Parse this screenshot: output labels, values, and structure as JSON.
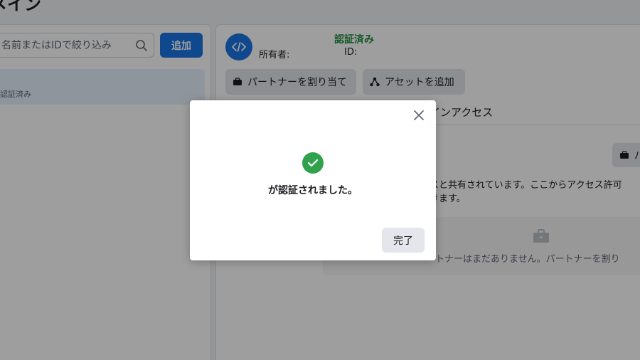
{
  "page": {
    "title": "メイン"
  },
  "left_panel": {
    "search": {
      "placeholder": "名前またはIDで絞り込み"
    },
    "add_button_label": "追加",
    "list": [
      {
        "status": "認証済み"
      }
    ]
  },
  "right_panel": {
    "status": "認証済み",
    "owner_label": "所有者:",
    "id_label": "ID:",
    "assign_partner_label": "パートナーを割り当て",
    "add_asset_label": "アセットを追加",
    "tab_access_label": "インアクセス",
    "partner_small_label": "パ",
    "shared_desc_line1": "スと共有されています。ここからアクセス許可",
    "shared_desc_line2": "きます。",
    "empty_text": "ートナーはまだありません。パートナーを割り"
  },
  "modal": {
    "message": "が認証されました。",
    "done_label": "完了"
  },
  "colors": {
    "primary": "#1b74e4",
    "verified": "#1e8e3e",
    "success": "#31a24c"
  },
  "icons": [
    "search-icon",
    "code-icon",
    "briefcase-icon",
    "share-icon",
    "close-icon",
    "check-icon"
  ]
}
